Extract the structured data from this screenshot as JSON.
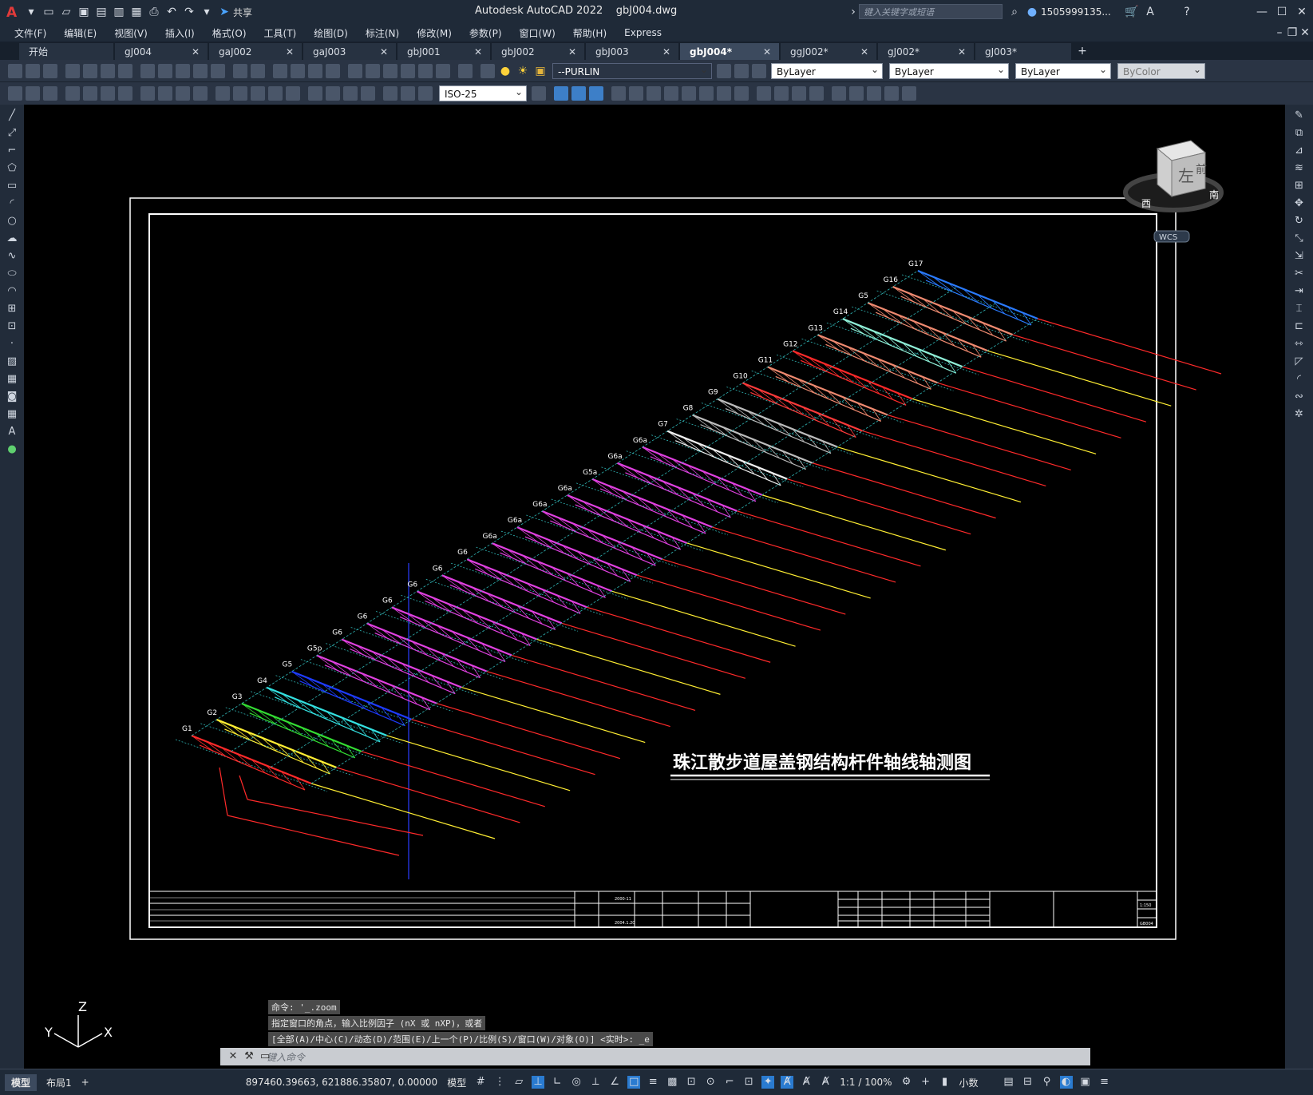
{
  "app": {
    "title": "Autodesk AutoCAD 2022",
    "filename": "gbJ004.dwg",
    "share_label": "共享",
    "search_placeholder": "键入关键字或短语",
    "user": "1505999135...",
    "logo": "A"
  },
  "menu": [
    "文件(F)",
    "编辑(E)",
    "视图(V)",
    "插入(I)",
    "格式(O)",
    "工具(T)",
    "绘图(D)",
    "标注(N)",
    "修改(M)",
    "参数(P)",
    "窗口(W)",
    "帮助(H)",
    "Express"
  ],
  "tabs": [
    {
      "label": "开始",
      "closable": false,
      "active": false
    },
    {
      "label": "gJ004",
      "closable": true,
      "active": false
    },
    {
      "label": "gaJ002",
      "closable": true,
      "active": false
    },
    {
      "label": "gaJ003",
      "closable": true,
      "active": false
    },
    {
      "label": "gbJ001",
      "closable": true,
      "active": false
    },
    {
      "label": "gbJ002",
      "closable": true,
      "active": false
    },
    {
      "label": "gbJ003",
      "closable": true,
      "active": false
    },
    {
      "label": "gbJ004*",
      "closable": true,
      "active": true
    },
    {
      "label": "ggJ002*",
      "closable": true,
      "active": false
    },
    {
      "label": "gJ002*",
      "closable": true,
      "active": false
    },
    {
      "label": "gJ003*",
      "closable": false,
      "active": false
    }
  ],
  "toolbar": {
    "layer": "--PURLIN",
    "color": "ByLayer",
    "linetype": "ByLayer",
    "lineweight": "ByLayer",
    "plotstyle": "ByColor",
    "dimstyle": "ISO-25"
  },
  "viewcube": {
    "face_left": "左",
    "face_front": "前",
    "compass_w": "西",
    "compass_s": "南",
    "wcs": "WCS"
  },
  "drawing": {
    "title": "珠江散步道屋盖钢结构杆件轴线轴测图",
    "labels": [
      "G1",
      "G2",
      "G3",
      "G4",
      "G5",
      "G5p",
      "G6",
      "G6",
      "G6",
      "G6",
      "G6",
      "G6",
      "G6a",
      "G6a",
      "G6a",
      "G6a",
      "G5a",
      "G6a",
      "G6a",
      "G7",
      "G8",
      "G9",
      "G10",
      "G11",
      "G12",
      "G13",
      "G14",
      "G5",
      "G16",
      "G17"
    ],
    "titleblock": [
      "2000-11",
      "2004.1.20",
      "GB004",
      "1:150"
    ]
  },
  "ucs": {
    "z": "Z",
    "x": "X",
    "y": "Y"
  },
  "command": {
    "history": [
      "命令: '_.zoom",
      "指定窗口的角点，输入比例因子 (nX 或 nXP)，或者",
      "[全部(A)/中心(C)/动态(D)/范围(E)/上一个(P)/比例(S)/窗口(W)/对象(O)] <实时>: _e"
    ],
    "placeholder": "键入命令"
  },
  "status": {
    "model_tab": "模型",
    "layout_tab": "布局1",
    "add": "+",
    "coords": "897460.39663, 621886.35807, 0.00000",
    "space": "模型",
    "scale": "1:1 / 100%",
    "units": "小数"
  },
  "colors": {
    "canvas": "#000000",
    "chrome": "#1f2a38",
    "accent": "#2a7bd0"
  }
}
